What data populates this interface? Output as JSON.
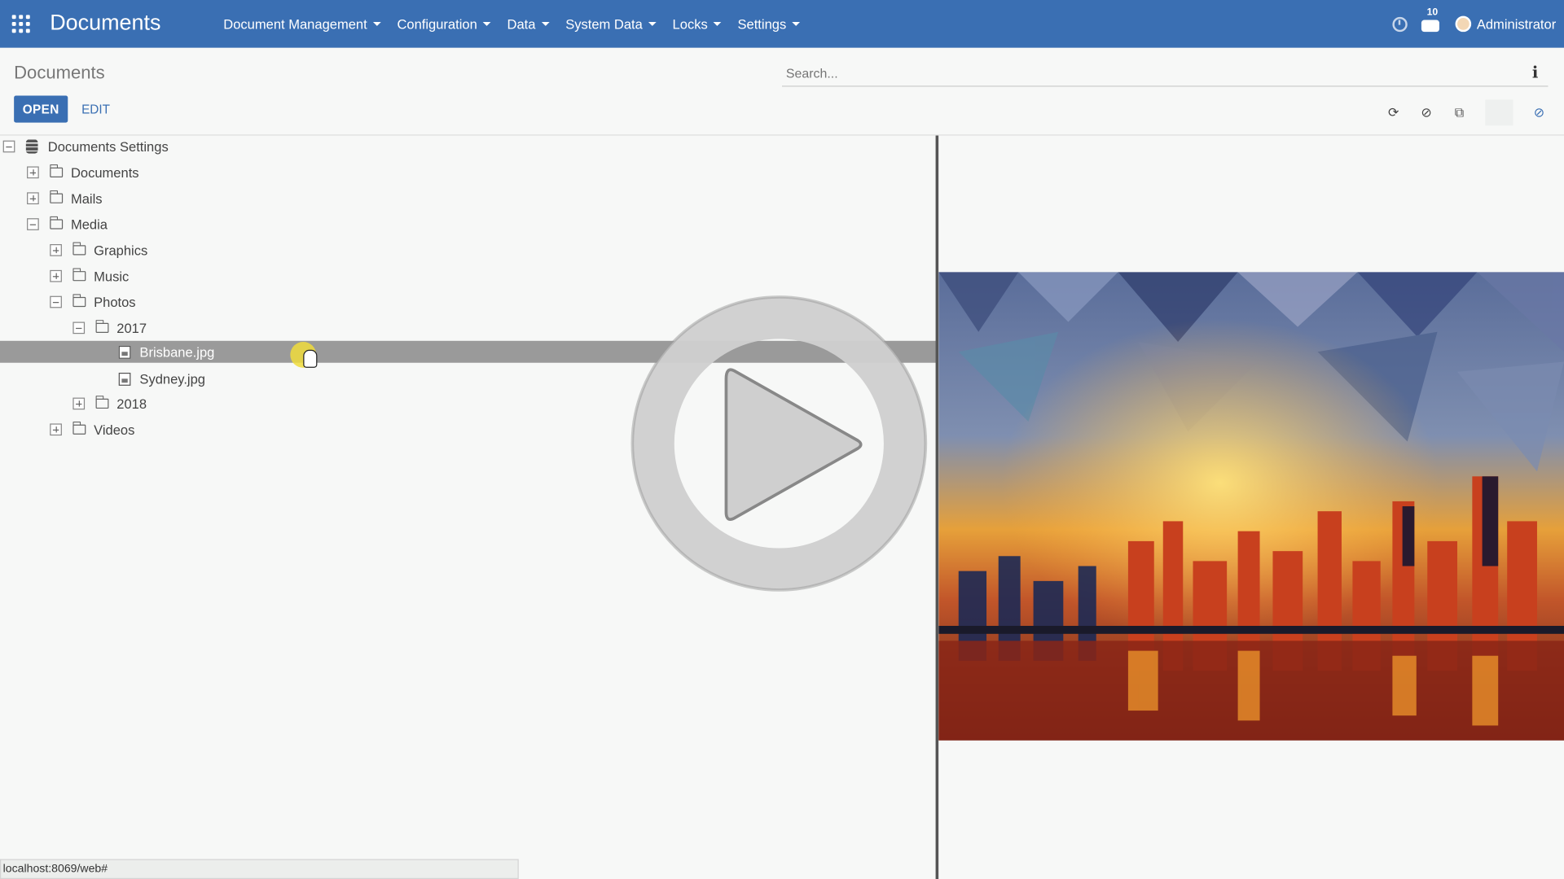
{
  "navbar": {
    "app_title": "Documents",
    "menu": [
      {
        "label": "Document Management"
      },
      {
        "label": "Configuration"
      },
      {
        "label": "Data"
      },
      {
        "label": "System Data"
      },
      {
        "label": "Locks"
      },
      {
        "label": "Settings"
      }
    ],
    "chat_badge": "10",
    "user_name": "Administrator",
    "color": "#3a6fb3"
  },
  "control_panel": {
    "breadcrumb": "Documents",
    "search_placeholder": "Search...",
    "open_label": "OPEN",
    "edit_label": "EDIT"
  },
  "tree": {
    "nodes": [
      {
        "label": "Documents Settings"
      },
      {
        "label": "Documents"
      },
      {
        "label": "Mails"
      },
      {
        "label": "Media"
      },
      {
        "label": "Graphics"
      },
      {
        "label": "Music"
      },
      {
        "label": "Photos"
      },
      {
        "label": "2017"
      },
      {
        "label": "Brisbane.jpg"
      },
      {
        "label": "Sydney.jpg"
      },
      {
        "label": "2018"
      },
      {
        "label": "Videos"
      }
    ]
  },
  "status_bar": {
    "url": "localhost:8069/web#"
  }
}
